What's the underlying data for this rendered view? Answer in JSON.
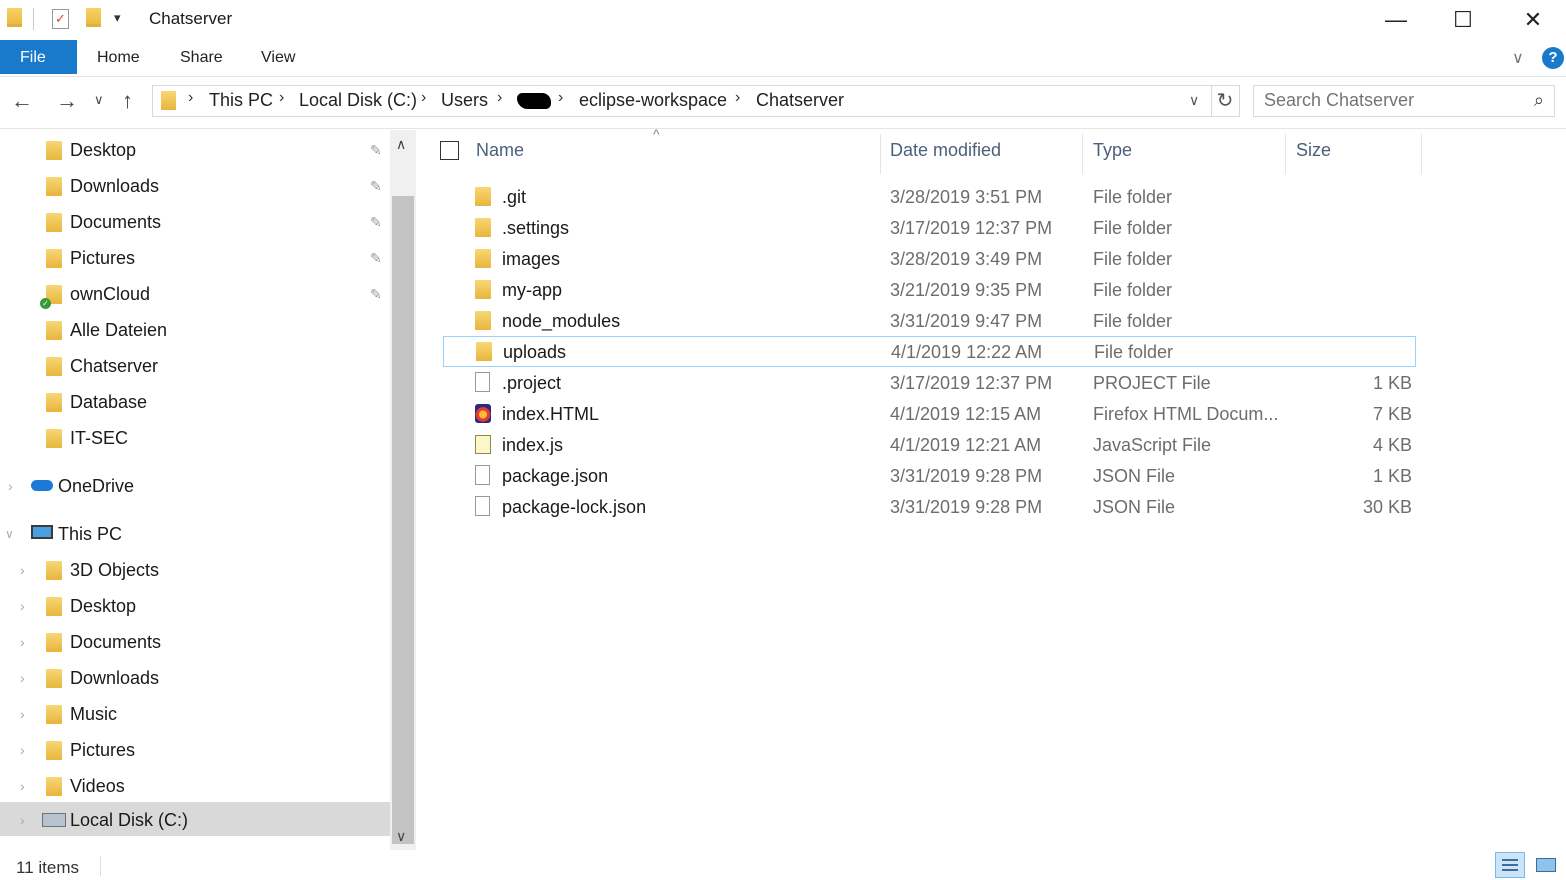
{
  "window": {
    "title": "Chatserver",
    "minimize_glyph": "—",
    "maximize_glyph": "☐",
    "close_glyph": "✕"
  },
  "ribbon": {
    "tabs": [
      {
        "label": "File"
      },
      {
        "label": "Home"
      },
      {
        "label": "Share"
      },
      {
        "label": "View"
      }
    ],
    "help_glyph": "?",
    "expand_glyph": "∨"
  },
  "nav": {
    "back_glyph": "←",
    "forward_glyph": "→",
    "recent_glyph": "∨",
    "up_glyph": "↑",
    "breadcrumbs": [
      "This PC",
      "Local Disk (C:)",
      "Users",
      "",
      "eclipse-workspace",
      "Chatserver"
    ],
    "search_placeholder": "Search Chatserver",
    "refresh_glyph": "↻",
    "dropdown_glyph": "∨"
  },
  "sidebar": {
    "quick_access": [
      {
        "label": "Desktop",
        "icon": "desktop-folder-icon",
        "pinned": true
      },
      {
        "label": "Downloads",
        "icon": "downloads-folder-icon",
        "pinned": true
      },
      {
        "label": "Documents",
        "icon": "documents-folder-icon",
        "pinned": true
      },
      {
        "label": "Pictures",
        "icon": "pictures-folder-icon",
        "pinned": true
      },
      {
        "label": "ownCloud",
        "icon": "owncloud-folder-icon",
        "pinned": true
      },
      {
        "label": "Alle Dateien",
        "icon": "folder-icon",
        "pinned": false
      },
      {
        "label": "Chatserver",
        "icon": "folder-icon",
        "pinned": false
      },
      {
        "label": "Database",
        "icon": "folder-icon",
        "pinned": false
      },
      {
        "label": "IT-SEC",
        "icon": "folder-icon",
        "pinned": false
      }
    ],
    "onedrive": {
      "label": "OneDrive",
      "icon": "onedrive-cloud-icon"
    },
    "this_pc": {
      "label": "This PC",
      "icon": "computer-icon"
    },
    "this_pc_children": [
      {
        "label": "3D Objects",
        "icon": "3d-objects-folder-icon"
      },
      {
        "label": "Desktop",
        "icon": "desktop-folder-icon"
      },
      {
        "label": "Documents",
        "icon": "documents-folder-icon"
      },
      {
        "label": "Downloads",
        "icon": "downloads-folder-icon"
      },
      {
        "label": "Music",
        "icon": "music-folder-icon"
      },
      {
        "label": "Pictures",
        "icon": "pictures-folder-icon"
      },
      {
        "label": "Videos",
        "icon": "videos-folder-icon"
      },
      {
        "label": "Local Disk (C:)",
        "icon": "local-disk-icon",
        "selected": true
      }
    ],
    "pin_glyph": "📌",
    "chevron_glyph": "›",
    "expanded_glyph": "∨"
  },
  "columns": {
    "name": "Name",
    "date": "Date modified",
    "type": "Type",
    "size": "Size",
    "sort_glyph": "^"
  },
  "files": [
    {
      "name": ".git",
      "date": "3/28/2019 3:51 PM",
      "type": "File folder",
      "size": "",
      "kind": "folder"
    },
    {
      "name": ".settings",
      "date": "3/17/2019 12:37 PM",
      "type": "File folder",
      "size": "",
      "kind": "folder"
    },
    {
      "name": "images",
      "date": "3/28/2019 3:49 PM",
      "type": "File folder",
      "size": "",
      "kind": "folder"
    },
    {
      "name": "my-app",
      "date": "3/21/2019 9:35 PM",
      "type": "File folder",
      "size": "",
      "kind": "folder"
    },
    {
      "name": "node_modules",
      "date": "3/31/2019 9:47 PM",
      "type": "File folder",
      "size": "",
      "kind": "folder"
    },
    {
      "name": "uploads",
      "date": "4/1/2019 12:22 AM",
      "type": "File folder",
      "size": "",
      "kind": "folder",
      "selected": true
    },
    {
      "name": ".project",
      "date": "3/17/2019 12:37 PM",
      "type": "PROJECT File",
      "size": "1 KB",
      "kind": "file"
    },
    {
      "name": "index.HTML",
      "date": "4/1/2019 12:15 AM",
      "type": "Firefox HTML Docum...",
      "size": "7 KB",
      "kind": "firefox"
    },
    {
      "name": "index.js",
      "date": "4/1/2019 12:21 AM",
      "type": "JavaScript File",
      "size": "4 KB",
      "kind": "js"
    },
    {
      "name": "package.json",
      "date": "3/31/2019 9:28 PM",
      "type": "JSON File",
      "size": "1 KB",
      "kind": "file"
    },
    {
      "name": "package-lock.json",
      "date": "3/31/2019 9:28 PM",
      "type": "JSON File",
      "size": "30 KB",
      "kind": "file"
    }
  ],
  "status": {
    "item_count": "11 items"
  }
}
